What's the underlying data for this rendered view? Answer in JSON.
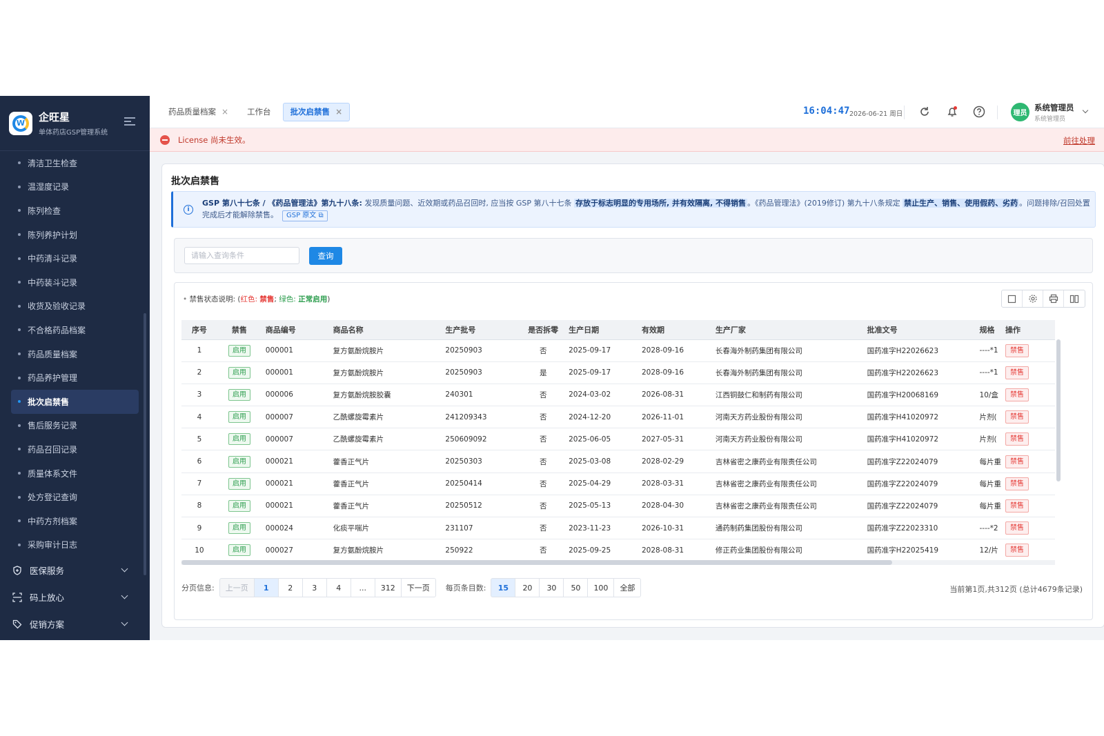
{
  "brand": {
    "name": "企旺星",
    "subtitle": "单体药店GSP管理系统"
  },
  "sidebar": {
    "items": [
      {
        "label": "清洁卫生检查",
        "active": false
      },
      {
        "label": "温湿度记录",
        "active": false
      },
      {
        "label": "陈列检查",
        "active": false
      },
      {
        "label": "陈列养护计划",
        "active": false
      },
      {
        "label": "中药清斗记录",
        "active": false
      },
      {
        "label": "中药装斗记录",
        "active": false
      },
      {
        "label": "收货及验收记录",
        "active": false
      },
      {
        "label": "不合格药品档案",
        "active": false
      },
      {
        "label": "药品质量档案",
        "active": false
      },
      {
        "label": "药品养护管理",
        "active": false
      },
      {
        "label": "批次启禁售",
        "active": true
      },
      {
        "label": "售后服务记录",
        "active": false
      },
      {
        "label": "药品召回记录",
        "active": false
      },
      {
        "label": "质量体系文件",
        "active": false
      },
      {
        "label": "处方登记查询",
        "active": false
      },
      {
        "label": "中药方剂档案",
        "active": false
      },
      {
        "label": "采购审计日志",
        "active": false
      }
    ],
    "groups": [
      {
        "label": "医保服务",
        "icon": "shield-plus-icon"
      },
      {
        "label": "码上放心",
        "icon": "scan-code-icon"
      },
      {
        "label": "促销方案",
        "icon": "tag-icon"
      }
    ]
  },
  "tabs": [
    {
      "label": "药品质量档案",
      "closable": true,
      "active": false
    },
    {
      "label": "工作台",
      "closable": false,
      "active": false
    },
    {
      "label": "批次启禁售",
      "closable": true,
      "active": true
    }
  ],
  "header": {
    "time": "16:04:47",
    "date": "2026-06-21 周日",
    "user_name": "系统管理员",
    "user_role": "系统管理员",
    "avatar_text": "理员"
  },
  "license": {
    "message": "License 尚未生效。",
    "action": "前往处理"
  },
  "page": {
    "title": "批次启禁售",
    "notice": {
      "lead": "GSP 第八十七条 / 《药品管理法》第九十八条:",
      "part1": " 发现质量问题、近效期或药品召回时, 应当按 GSP 第八十七条 ",
      "hl1": "存放于标志明显的专用场所, 并有效隔离, 不得销售",
      "part2": "。《药品管理法》(2019修订) 第九十八条规定 ",
      "hl2": "禁止生产、销售、使用假药、劣药",
      "part3": "。问题排除/召回处置完成后才能解除禁售。",
      "link": "GSP 原文"
    },
    "search": {
      "placeholder": "请输入查询条件",
      "button": "查询"
    },
    "legend": {
      "prefix": "禁售状态说明: (",
      "red_label": "红色: ",
      "red_value": "禁售",
      "sep": "; ",
      "green_label": "绿色: ",
      "green_value": "正常启用",
      "suffix": ")"
    }
  },
  "table": {
    "columns": [
      "序号",
      "禁售",
      "商品编号",
      "商品名称",
      "生产批号",
      "是否拆零",
      "生产日期",
      "有效期",
      "生产厂家",
      "批准文号",
      "规格",
      "操作"
    ],
    "rows": [
      {
        "no": "1",
        "status": "启用",
        "code": "000001",
        "name": "复方氨酚烷胺片",
        "batch": "20250903",
        "split": "否",
        "mfg": "2025-09-17",
        "exp": "2028-09-16",
        "maker": "长春海外制药集团有限公司",
        "approval": "国药准字H22026623",
        "spec": "----*1",
        "action": "禁售"
      },
      {
        "no": "2",
        "status": "启用",
        "code": "000001",
        "name": "复方氨酚烷胺片",
        "batch": "20250903",
        "split": "是",
        "mfg": "2025-09-17",
        "exp": "2028-09-16",
        "maker": "长春海外制药集团有限公司",
        "approval": "国药准字H22026623",
        "spec": "----*1",
        "action": "禁售"
      },
      {
        "no": "3",
        "status": "启用",
        "code": "000006",
        "name": "复方氨酚烷胺胶囊",
        "batch": "240301",
        "split": "否",
        "mfg": "2024-03-02",
        "exp": "2026-08-31",
        "maker": "江西铜鼓仁和制药有限公司",
        "approval": "国药准字H20068169",
        "spec": "10/盒",
        "action": "禁售"
      },
      {
        "no": "4",
        "status": "启用",
        "code": "000007",
        "name": "乙酰螺旋霉素片",
        "batch": "241209343",
        "split": "否",
        "mfg": "2024-12-20",
        "exp": "2026-11-01",
        "maker": "河南天方药业股份有限公司",
        "approval": "国药准字H41020972",
        "spec": "片剂(",
        "action": "禁售"
      },
      {
        "no": "5",
        "status": "启用",
        "code": "000007",
        "name": "乙酰螺旋霉素片",
        "batch": "250609092",
        "split": "否",
        "mfg": "2025-06-05",
        "exp": "2027-05-31",
        "maker": "河南天方药业股份有限公司",
        "approval": "国药准字H41020972",
        "spec": "片剂(",
        "action": "禁售"
      },
      {
        "no": "6",
        "status": "启用",
        "code": "000021",
        "name": "藿香正气片",
        "batch": "20250303",
        "split": "否",
        "mfg": "2025-03-08",
        "exp": "2028-02-29",
        "maker": "吉林省密之康药业有限责任公司",
        "approval": "国药准字Z22024079",
        "spec": "每片重",
        "action": "禁售"
      },
      {
        "no": "7",
        "status": "启用",
        "code": "000021",
        "name": "藿香正气片",
        "batch": "20250414",
        "split": "否",
        "mfg": "2025-04-29",
        "exp": "2028-03-31",
        "maker": "吉林省密之康药业有限责任公司",
        "approval": "国药准字Z22024079",
        "spec": "每片重",
        "action": "禁售"
      },
      {
        "no": "8",
        "status": "启用",
        "code": "000021",
        "name": "藿香正气片",
        "batch": "20250512",
        "split": "否",
        "mfg": "2025-05-13",
        "exp": "2028-04-30",
        "maker": "吉林省密之康药业有限责任公司",
        "approval": "国药准字Z22024079",
        "spec": "每片重",
        "action": "禁售"
      },
      {
        "no": "9",
        "status": "启用",
        "code": "000024",
        "name": "化痰平喘片",
        "batch": "231107",
        "split": "否",
        "mfg": "2023-11-23",
        "exp": "2026-10-31",
        "maker": "通药制药集团股份有限公司",
        "approval": "国药准字Z22023310",
        "spec": "----*2",
        "action": "禁售"
      },
      {
        "no": "10",
        "status": "启用",
        "code": "000027",
        "name": "复方氨酚烷胺片",
        "batch": "250922",
        "split": "否",
        "mfg": "2025-09-25",
        "exp": "2028-08-31",
        "maker": "修正药业集团股份有限公司",
        "approval": "国药准字H22025419",
        "spec": "12/片",
        "action": "禁售"
      }
    ]
  },
  "pagination": {
    "label": "分页信息:",
    "prev": "上一页",
    "pages": [
      "1",
      "2",
      "3",
      "4",
      "...",
      "312"
    ],
    "current": "1",
    "next": "下一页",
    "size_label": "每页条目数:",
    "sizes": [
      "15",
      "20",
      "30",
      "50",
      "100",
      "全部"
    ],
    "current_size": "15",
    "summary": "当前第1页,共312页 (总计4679条记录)"
  },
  "colors": {
    "primary": "#1e88e5",
    "sidebar_bg": "#1e2b44",
    "enabled": "#2e9e4f",
    "banned": "#e53935"
  }
}
